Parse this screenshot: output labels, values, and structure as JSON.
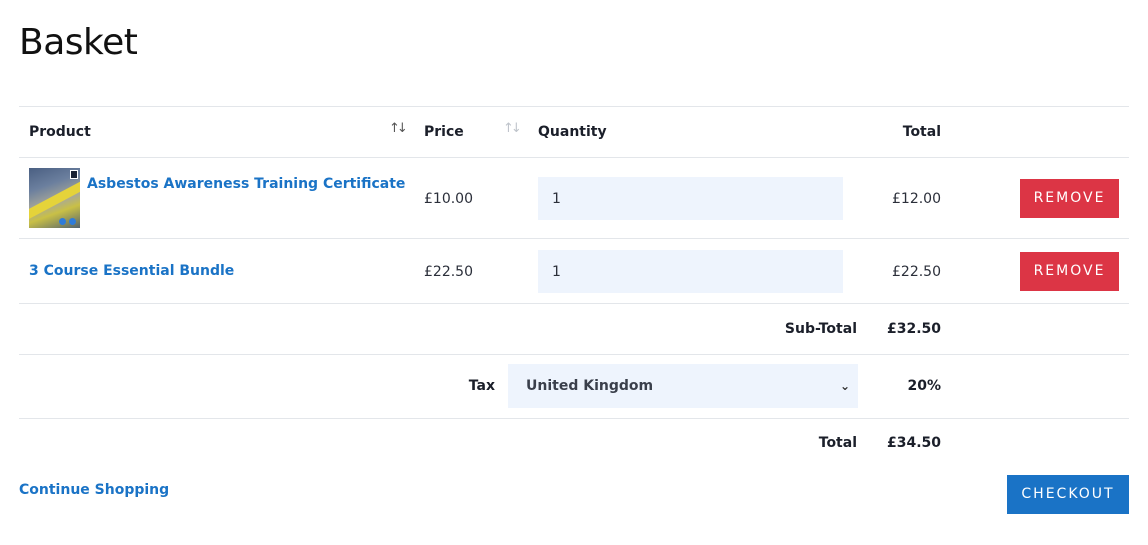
{
  "page": {
    "title": "Basket"
  },
  "table": {
    "headers": {
      "product": "Product",
      "price": "Price",
      "quantity": "Quantity",
      "total": "Total"
    },
    "sort_glyph": "↑↓",
    "items": [
      {
        "name": "Asbestos Awareness Training Certificate",
        "price": "£10.00",
        "quantity": "1",
        "total": "£12.00",
        "remove_label": "REMOVE"
      },
      {
        "name": "3 Course Essential Bundle",
        "price": "£22.50",
        "quantity": "1",
        "total": "£22.50",
        "remove_label": "REMOVE"
      }
    ]
  },
  "summary": {
    "subtotal_label": "Sub-Total",
    "subtotal_value": "£32.50",
    "tax_label": "Tax",
    "tax_country": "United Kingdom",
    "tax_rate": "20%",
    "total_label": "Total",
    "total_value": "£34.50"
  },
  "actions": {
    "continue_label": "Continue Shopping",
    "checkout_label": "CHECKOUT"
  },
  "icons": {
    "select_chevron": "chevron-down-icon",
    "sort": "sort-icon"
  },
  "colors": {
    "link": "#1a73c6",
    "remove": "#dc3545",
    "checkout": "#1a73c6",
    "input_bg": "#eef4fd"
  }
}
